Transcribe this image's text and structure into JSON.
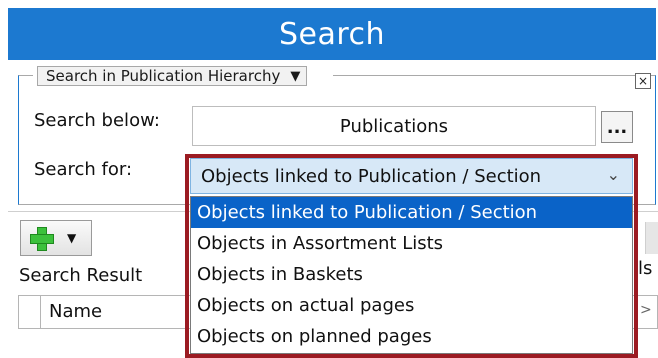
{
  "window": {
    "title": "Search"
  },
  "scope_group": {
    "mode_label": "Search in Publication Hierarchy",
    "close_glyph": "×"
  },
  "search_below": {
    "label": "Search below:",
    "value": "Publications",
    "browse_label": "..."
  },
  "search_for": {
    "label": "Search for:",
    "selected": "Objects linked to Publication / Section",
    "options": [
      "Objects linked to Publication / Section",
      "Objects in Assortment Lists",
      "Objects in Baskets",
      "Objects on actual pages",
      "Objects on planned pages"
    ]
  },
  "results": {
    "label": "Search Result",
    "columns": [
      "Name"
    ],
    "right_tab_partial": "ls"
  },
  "colors": {
    "titlebar": "#1c79d0",
    "selection": "#0a63c8",
    "highlight_frame": "#9b1b22"
  }
}
